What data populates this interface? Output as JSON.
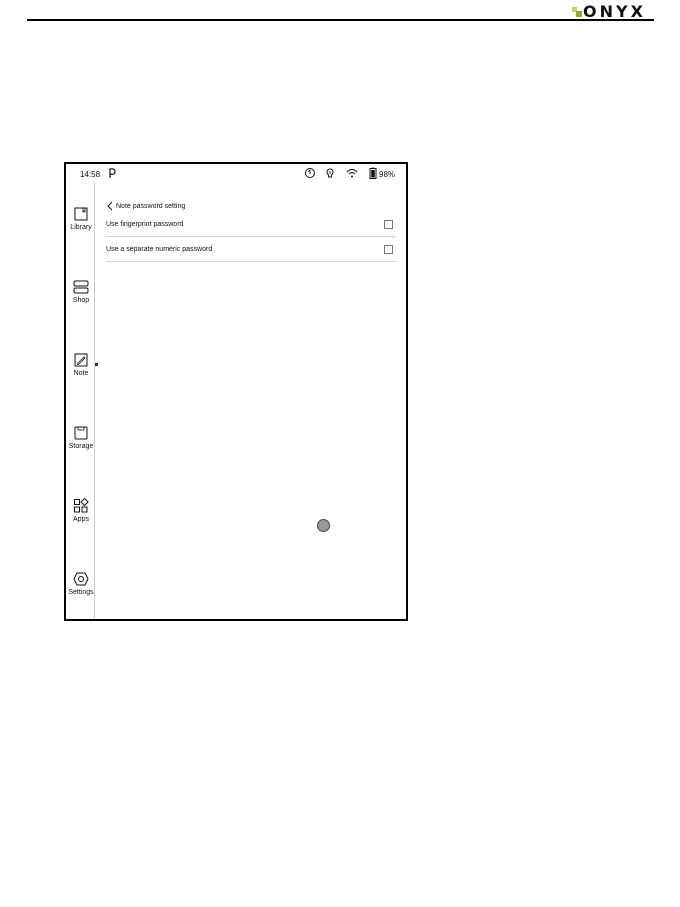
{
  "header": {
    "brand_text": "ONYX"
  },
  "statusbar": {
    "time": "14:58",
    "battery": "98%",
    "icons": [
      "p-logo-icon",
      "sync-icon",
      "bulb-icon",
      "wifi-icon",
      "battery-icon"
    ]
  },
  "sidebar": {
    "items": [
      {
        "label": "Library",
        "icon": "book-icon"
      },
      {
        "label": "Shop",
        "icon": "shop-icon"
      },
      {
        "label": "Note",
        "icon": "note-icon"
      },
      {
        "label": "Storage",
        "icon": "storage-icon"
      },
      {
        "label": "Apps",
        "icon": "apps-icon"
      },
      {
        "label": "Settings",
        "icon": "settings-icon"
      }
    ]
  },
  "page": {
    "title": "Note password setting",
    "options": [
      {
        "label": "Use fingerprint password",
        "checked": false
      },
      {
        "label": "Use a separate numeric password",
        "checked": false
      }
    ]
  },
  "colors": {
    "logo_light": "#c6d64a",
    "logo_dark": "#8fae2c"
  }
}
